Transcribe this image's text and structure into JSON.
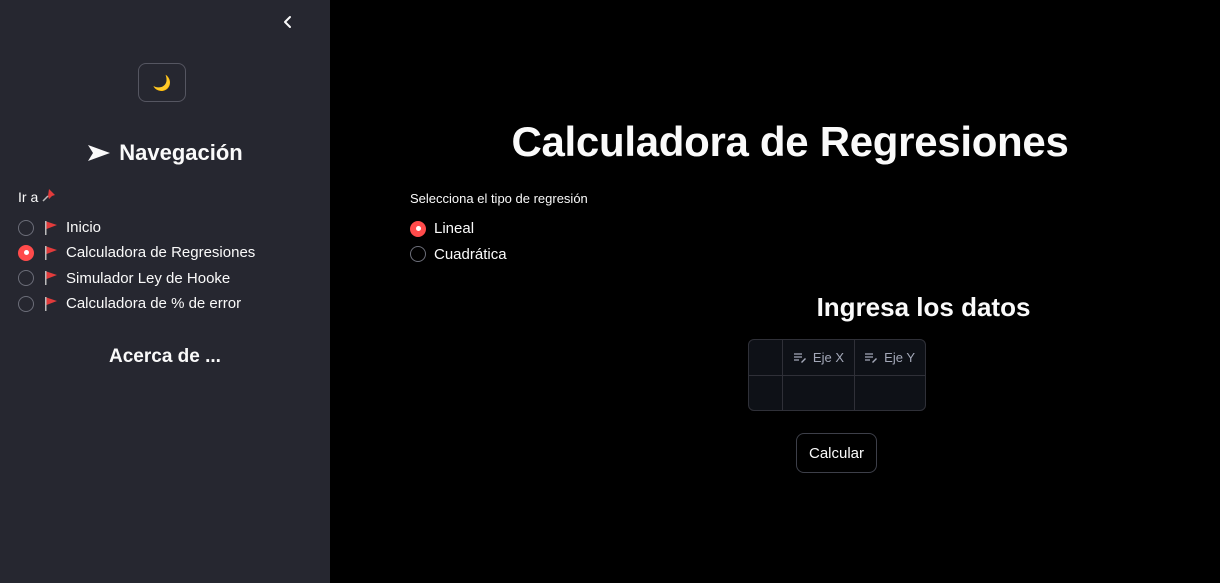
{
  "sidebar": {
    "theme_toggle_icon": "🌙",
    "nav_title": "Navegación",
    "goto_label": "Ir a",
    "goto_icon": "pushpin-icon",
    "items": [
      {
        "label": "Inicio",
        "selected": false
      },
      {
        "label": "Calculadora de Regresiones",
        "selected": true
      },
      {
        "label": "Simulador Ley de Hooke",
        "selected": false
      },
      {
        "label": "Calculadora de % de error",
        "selected": false
      }
    ],
    "about": "Acerca de ..."
  },
  "main": {
    "title": "Calculadora de Regresiones",
    "select_label": "Selecciona el tipo de regresión",
    "regression_options": [
      {
        "label": "Lineal",
        "selected": true
      },
      {
        "label": "Cuadrática",
        "selected": false
      }
    ],
    "data_title": "Ingresa los datos",
    "table": {
      "columns": [
        "Eje X",
        "Eje Y"
      ]
    },
    "calculate_label": "Calcular"
  },
  "colors": {
    "accent": "#ff4b4b",
    "sidebar_bg": "#262730",
    "main_bg": "#000000"
  }
}
